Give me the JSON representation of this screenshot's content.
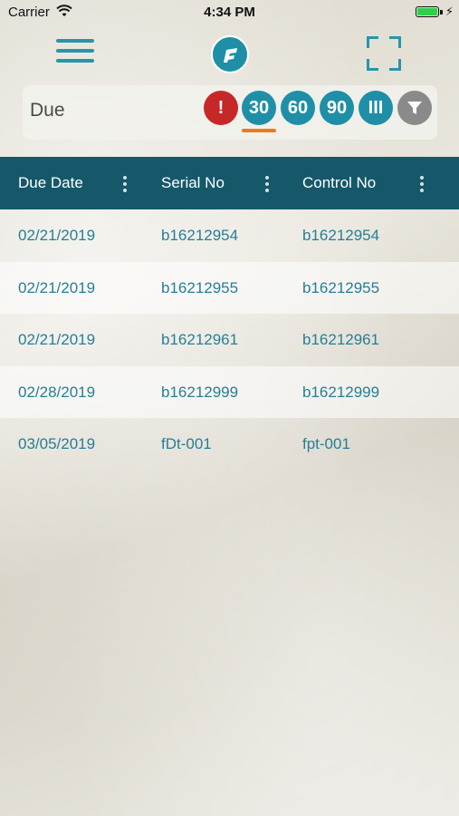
{
  "status": {
    "carrier": "Carrier",
    "time": "4:34 PM"
  },
  "filter": {
    "label": "Due",
    "chips": [
      "!",
      "30",
      "60",
      "90",
      "III"
    ]
  },
  "table": {
    "headers": [
      "Due Date",
      "Serial No",
      "Control No"
    ],
    "rows": [
      [
        "02/21/2019",
        "b16212954",
        "b16212954"
      ],
      [
        "02/21/2019",
        "b16212955",
        "b16212955"
      ],
      [
        "02/21/2019",
        "b16212961",
        "b16212961"
      ],
      [
        "02/28/2019",
        "b16212999",
        "b16212999"
      ],
      [
        "03/05/2019",
        "fDt-001",
        "fpt-001"
      ]
    ]
  },
  "colors": {
    "accent": "#1e8fa6",
    "header": "#15586a",
    "alert": "#c62828",
    "selected_underline": "#ef7a1a"
  }
}
